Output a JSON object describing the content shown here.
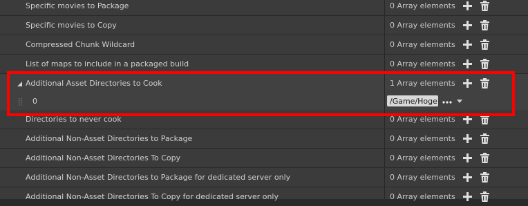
{
  "properties": [
    {
      "label": "Specific movies to Package",
      "count": "0 Array elements"
    },
    {
      "label": "Specific movies to Copy",
      "count": "0 Array elements"
    },
    {
      "label": "Compressed Chunk Wildcard",
      "count": "0 Array elements"
    },
    {
      "label": "List of maps to include in a packaged build",
      "count": "0 Array elements"
    },
    {
      "label": "Additional Asset Directories to Cook",
      "count": "1 Array elements"
    },
    {
      "label": "Directories to never cook",
      "count": "0 Array elements"
    },
    {
      "label": "Additional Non-Asset Directories to Package",
      "count": "0 Array elements"
    },
    {
      "label": "Additional Non-Asset Directories To Copy",
      "count": "0 Array elements"
    },
    {
      "label": "Additional Non-Asset Directories to Package for dedicated server only",
      "count": "0 Array elements"
    },
    {
      "label": "Additional Non-Asset Directories To Copy for dedicated server only",
      "count": "0 Array elements"
    }
  ],
  "array_element": {
    "index": "0",
    "value": "/Game/Hoge"
  },
  "icons": {
    "add": "plus-icon",
    "delete": "trash-icon",
    "expand": "expand-triangle-icon",
    "browse": "ellipsis-icon",
    "combo": "chevron-down-icon",
    "drag": "drag-grip-icon"
  },
  "colors": {
    "highlight_border": "#ff0000",
    "row_background": "#3b3b3b",
    "text": "#d0d0d0",
    "field_background": "#d9d9d9"
  }
}
